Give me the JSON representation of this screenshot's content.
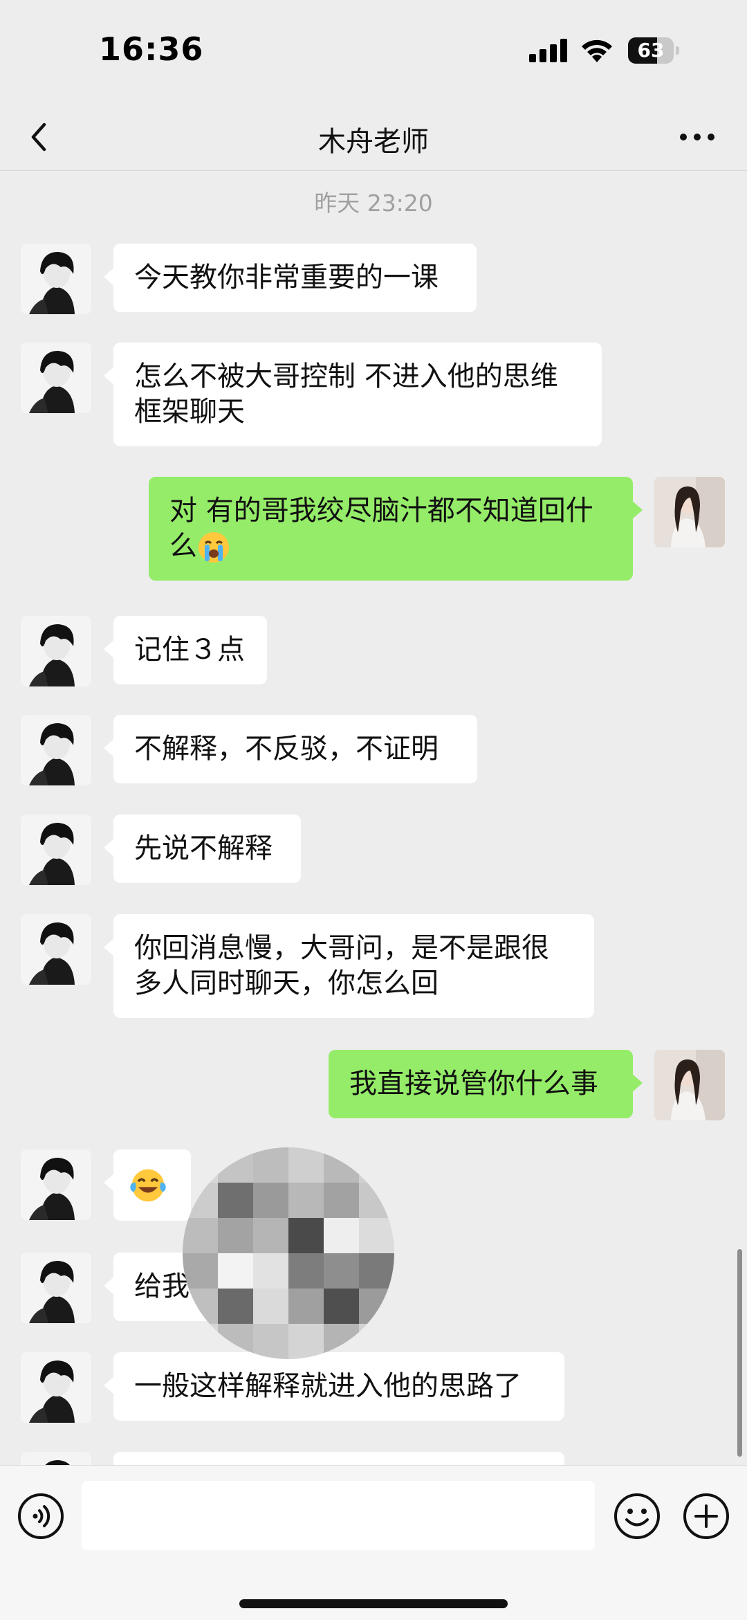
{
  "status_bar": {
    "time": "16:36",
    "battery_level": "63",
    "battery_fraction": 0.63,
    "icons": [
      "signal-icon",
      "wifi-icon",
      "battery-icon"
    ]
  },
  "header": {
    "back_icon": "chevron-left-icon",
    "title": "木舟老师",
    "more_icon": "more-dots-icon"
  },
  "chat": {
    "timestamp": "昨天 23:20",
    "messages": [
      {
        "side": "in",
        "lines": [
          "今天教你非常重要的一课"
        ]
      },
      {
        "side": "in",
        "lines": [
          "怎么不被大哥控制 不进入他的思维",
          "框架聊天"
        ]
      },
      {
        "side": "out",
        "lines": [
          "对 有的哥我绞尽脑汁都不知道回什",
          "么"
        ],
        "emoji": "crying-face-emoji"
      },
      {
        "side": "in",
        "lines": [
          "记住３点"
        ]
      },
      {
        "side": "in",
        "lines": [
          "不解释，不反驳，不证明"
        ]
      },
      {
        "side": "in",
        "lines": [
          "先说不解释"
        ]
      },
      {
        "side": "in",
        "lines": [
          "你回消息慢，大哥问，是不是跟很",
          "多人同时聊天，你怎么回"
        ]
      },
      {
        "side": "out",
        "lines": [
          "我直接说管你什么事"
        ]
      },
      {
        "side": "in",
        "lines": [
          ""
        ],
        "emoji": "tears-of-joy-emoji"
      },
      {
        "side": "in",
        "lines": [
          "给我"
        ]
      },
      {
        "side": "in",
        "lines": [
          "一般这样解释就进入他的思路了"
        ]
      }
    ]
  },
  "input_bar": {
    "voice_icon": "voice-icon",
    "emoji_icon": "emoji-smile-icon",
    "plus_icon": "plus-icon",
    "input_value": ""
  },
  "colors": {
    "background": "#ededed",
    "outgoing_bubble": "#95ec69",
    "incoming_bubble": "#ffffff",
    "timestamp_text": "#a0a0a0"
  }
}
